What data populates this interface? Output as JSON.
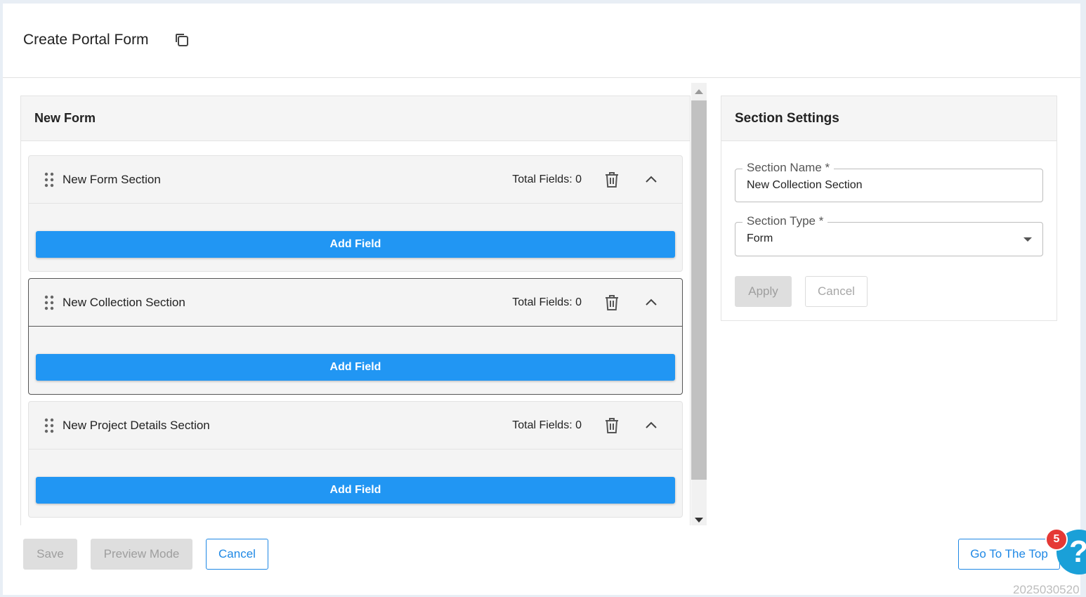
{
  "page": {
    "title": "Create Portal Form",
    "copy_icon": "copy-icon"
  },
  "builder": {
    "title": "New Form",
    "sections": [
      {
        "name": "New Form Section",
        "total_fields": "Total Fields: 0",
        "add_label": "Add Field",
        "selected": false
      },
      {
        "name": "New Collection Section",
        "total_fields": "Total Fields: 0",
        "add_label": "Add Field",
        "selected": true
      },
      {
        "name": "New Project Details Section",
        "total_fields": "Total Fields: 0",
        "add_label": "Add Field",
        "selected": false
      }
    ]
  },
  "settings": {
    "title": "Section Settings",
    "section_name_label": "Section Name *",
    "section_name_value": "New Collection Section",
    "section_type_label": "Section Type *",
    "section_type_value": "Form",
    "apply_label": "Apply",
    "cancel_label": "Cancel"
  },
  "footer": {
    "save_label": "Save",
    "preview_label": "Preview Mode",
    "cancel_label": "Cancel",
    "top_label": "Go To The Top",
    "help_badge": "5",
    "help_glyph": "?",
    "version": "2025030520"
  },
  "colors": {
    "primary": "#2196f3",
    "accent_text": "#1e88e5",
    "badge": "#e53935",
    "help": "#1aa0d8"
  }
}
